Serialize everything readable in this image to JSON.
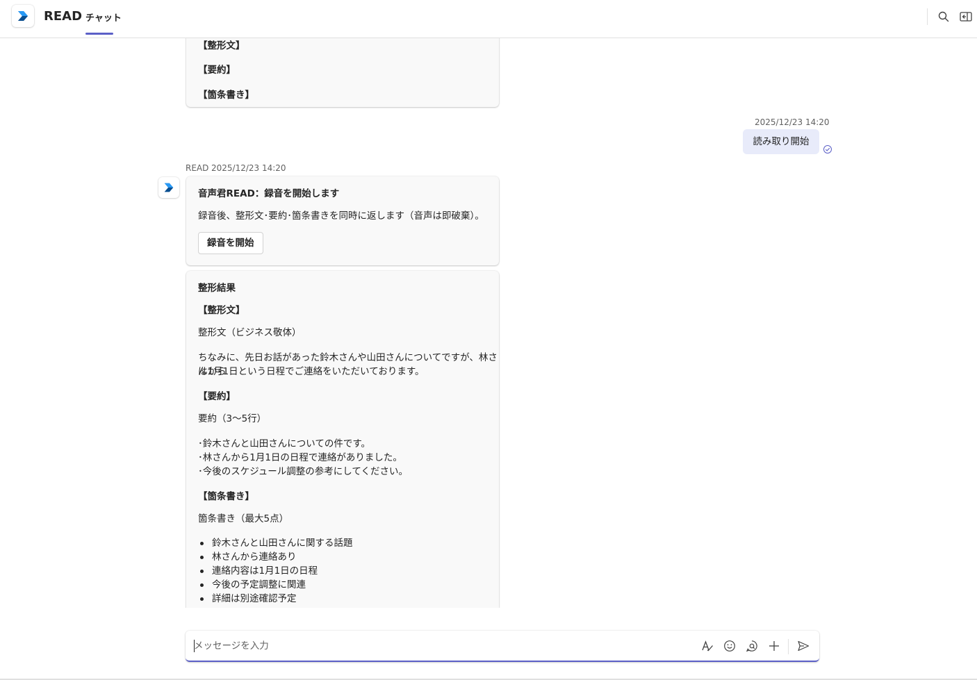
{
  "header": {
    "app_title": "READ",
    "tab_chat": "チャット",
    "accent": "#5b5fc7"
  },
  "messages": {
    "prev_card": {
      "line1": "【整形文】",
      "line2": "【要約】",
      "line3": "【箇条書き】"
    },
    "sent": {
      "timestamp": "2025/12/23 14:20",
      "text": "読み取り開始"
    },
    "bot": {
      "sender": "READ",
      "timestamp": "2025/12/23 14:20",
      "card1": {
        "title": "音声君READ：録音を開始します",
        "body": "録音後、整形文･要約･箇条書きを同時に返します（音声は即破棄）。",
        "button": "録音を開始"
      },
      "card2": {
        "title": "整形結果",
        "h_formatted": "【整形文】",
        "formatted_sub": "整形文（ビジネス敬体）",
        "formatted_line1": "ちなみに、先日お話があった鈴木さんや山田さんについてですが、林さんから",
        "formatted_line2": "は1月1日という日程でご連絡をいただいております。",
        "h_summary": "【要約】",
        "summary_sub": "要約（3〜5行）",
        "summary_lines": [
          "･鈴木さんと山田さんについての件です。",
          "･林さんから1月1日の日程で連絡がありました。",
          "･今後のスケジュール調整の参考にしてください。"
        ],
        "h_bullets": "【箇条書き】",
        "bullets_sub": "箇条書き（最大5点）",
        "bullets": [
          "鈴木さんと山田さんに関する話題",
          "林さんから連絡あり",
          "連絡内容は1月1日の日程",
          "今後の予定調整に関連",
          "詳細は別途確認予定"
        ]
      }
    }
  },
  "compose": {
    "placeholder": "メッセージを入力",
    "value": ""
  },
  "icons": {
    "app_logo": "power-automate-logo",
    "search": "search-icon",
    "pane": "open-pane-icon",
    "format": "format-icon",
    "emoji": "emoji-icon",
    "loop": "loop-icon",
    "plus": "plus-icon",
    "send": "send-icon",
    "receipt": "read-receipt-icon"
  }
}
